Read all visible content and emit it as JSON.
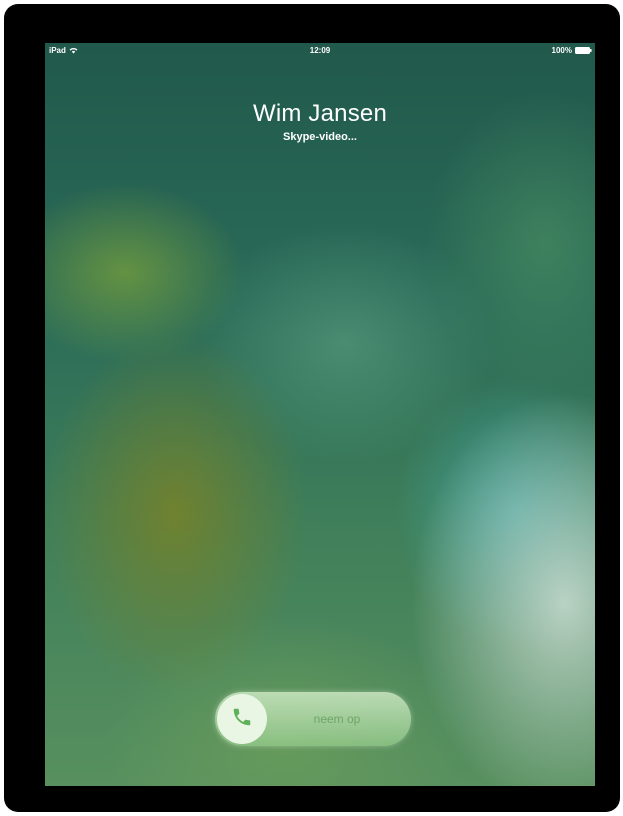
{
  "status_bar": {
    "device": "iPad",
    "time": "12:09",
    "battery": "100%"
  },
  "call": {
    "caller_name": "Wim Jansen",
    "call_type": "Skype-video..."
  },
  "answer_slider": {
    "label": "neem op",
    "accent_color": "#5fb05a"
  },
  "icons": {
    "wifi": "wifi-icon",
    "battery": "battery-icon",
    "phone": "phone-icon"
  }
}
